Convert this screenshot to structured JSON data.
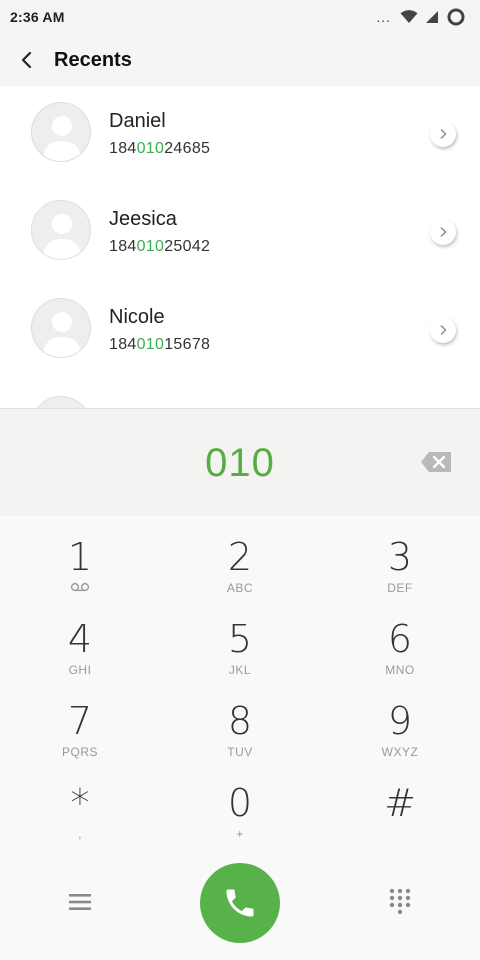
{
  "status_bar": {
    "time": "2:36 AM",
    "dots": "..."
  },
  "app_bar": {
    "title": "Recents"
  },
  "contacts": [
    {
      "name": "Daniel",
      "number_pre": "184",
      "number_match": "010",
      "number_post": "24685"
    },
    {
      "name": "Jeesica",
      "number_pre": "184",
      "number_match": "010",
      "number_post": "25042"
    },
    {
      "name": "Nicole",
      "number_pre": "184",
      "number_match": "010",
      "number_post": "15678"
    }
  ],
  "dialer": {
    "digits": "010"
  },
  "keys": [
    {
      "num": "1",
      "sub": "",
      "icon": "voicemail-icon"
    },
    {
      "num": "2",
      "sub": "ABC"
    },
    {
      "num": "3",
      "sub": "DEF"
    },
    {
      "num": "4",
      "sub": "GHI"
    },
    {
      "num": "5",
      "sub": "JKL"
    },
    {
      "num": "6",
      "sub": "MNO"
    },
    {
      "num": "7",
      "sub": "PQRS"
    },
    {
      "num": "8",
      "sub": "TUV"
    },
    {
      "num": "9",
      "sub": "WXYZ"
    },
    {
      "num": "*",
      "sub": ","
    },
    {
      "num": "0",
      "sub": "+"
    },
    {
      "num": "#",
      "sub": ""
    }
  ],
  "colors": {
    "accent": "#58ab46",
    "match_highlight": "#3dae4e",
    "call_button": "#58b24a"
  },
  "icons": {
    "back": "chevron-left-icon",
    "backspace": "backspace-icon",
    "menu": "menu-icon",
    "call": "phone-icon",
    "dialpad": "dialpad-icon"
  }
}
